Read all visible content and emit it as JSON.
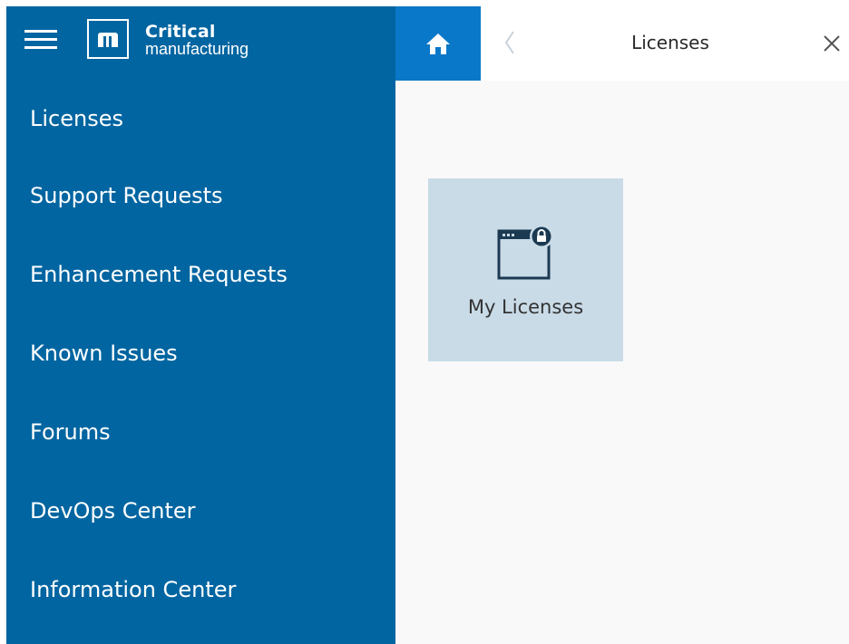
{
  "brand": {
    "name_line1": "Critical",
    "name_line2": "manufacturing"
  },
  "sidebar": {
    "items": [
      {
        "label": "Licenses"
      },
      {
        "label": "Support Requests"
      },
      {
        "label": "Enhancement Requests"
      },
      {
        "label": "Known Issues"
      },
      {
        "label": "Forums"
      },
      {
        "label": "DevOps Center"
      },
      {
        "label": "Information Center"
      }
    ]
  },
  "header": {
    "title": "Licenses",
    "icons": {
      "home": "home-icon",
      "back": "chevron-left-icon",
      "close": "close-icon"
    }
  },
  "main": {
    "tiles": [
      {
        "label": "My Licenses",
        "icon": "window-lock-icon"
      }
    ]
  },
  "colors": {
    "sidebar_bg": "#0065a1",
    "home_tab_bg": "#0a78c8",
    "tile_bg": "#c9dbe7",
    "content_bg": "#f9f9f9"
  }
}
